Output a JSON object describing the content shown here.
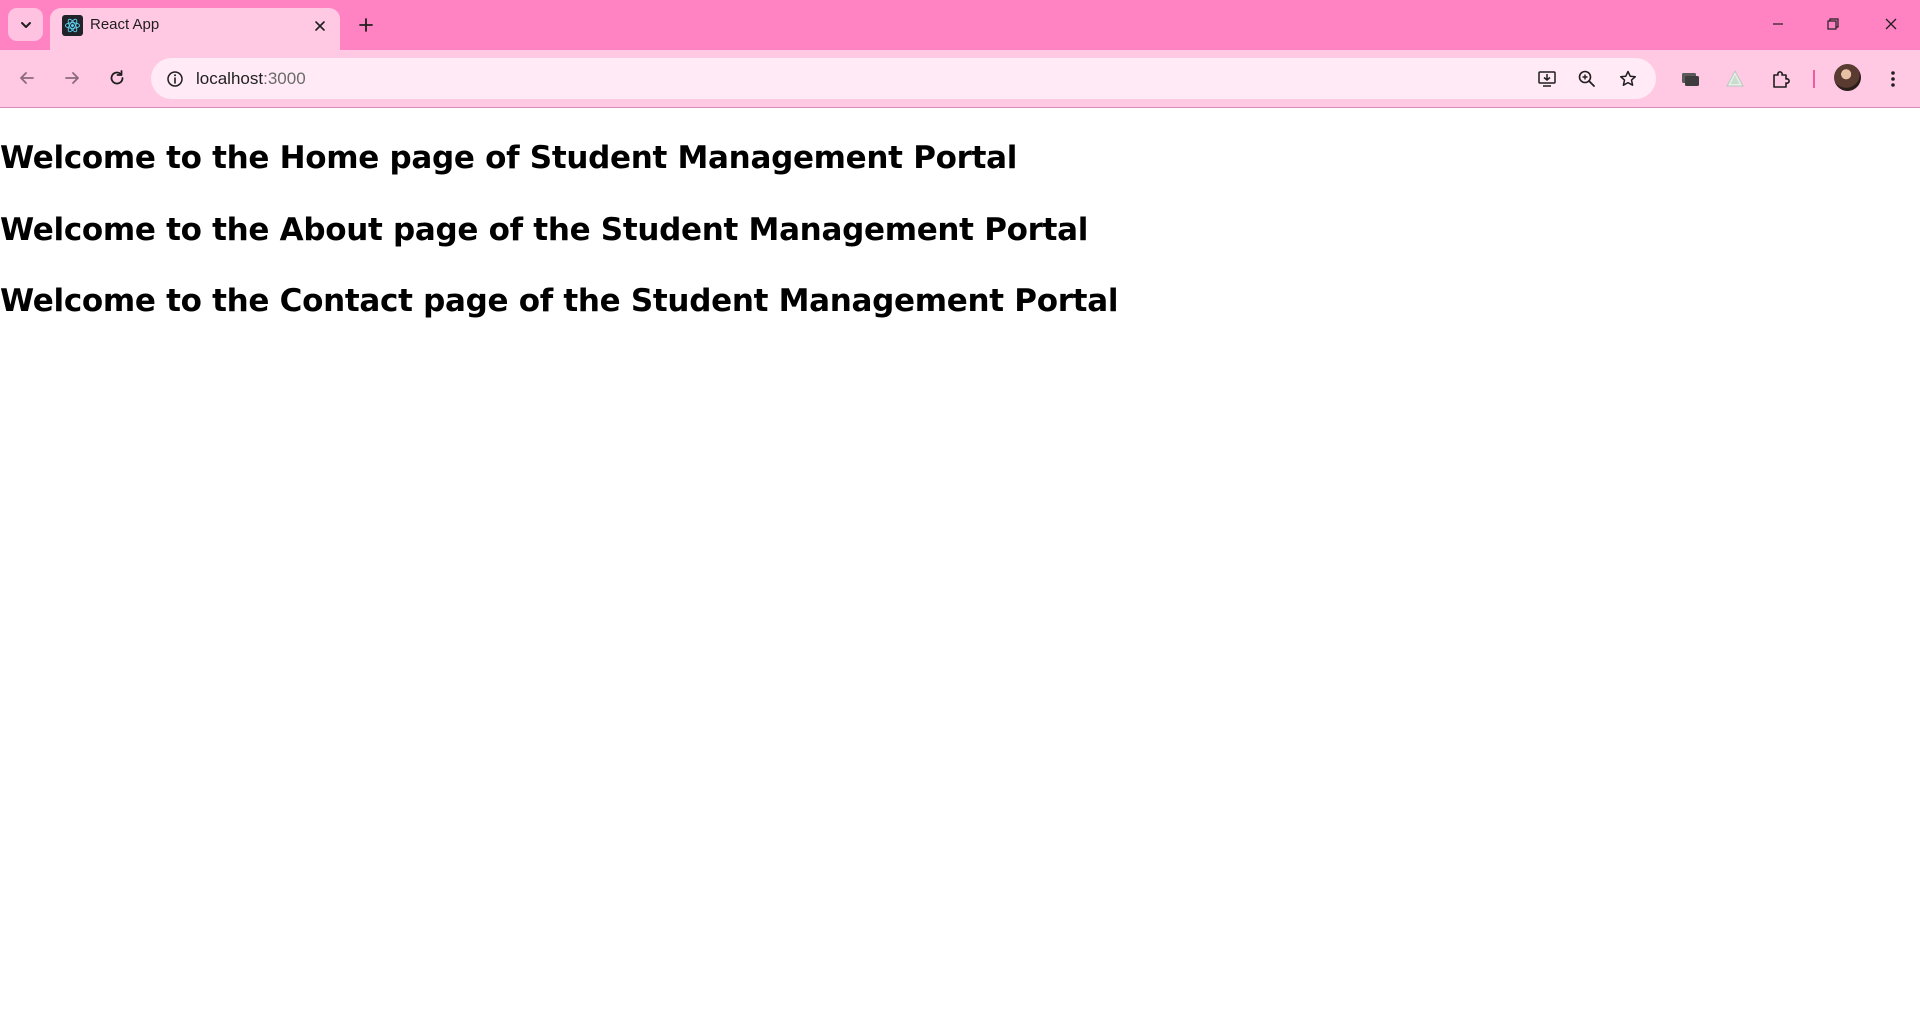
{
  "browser": {
    "tab": {
      "title": "React App",
      "favicon": "react-logo-icon"
    },
    "address_bar": {
      "host": "localhost",
      "port": ":3000"
    },
    "colors": {
      "tabstrip": "#ff83c2",
      "toolbar": "#ffc9e4",
      "omnibox": "#ffeaf5"
    }
  },
  "page": {
    "headings": [
      "Welcome to the Home page of Student Management Portal",
      "Welcome to the About page of the Student Management Portal",
      "Welcome to the Contact page of the Student Management Portal"
    ]
  }
}
